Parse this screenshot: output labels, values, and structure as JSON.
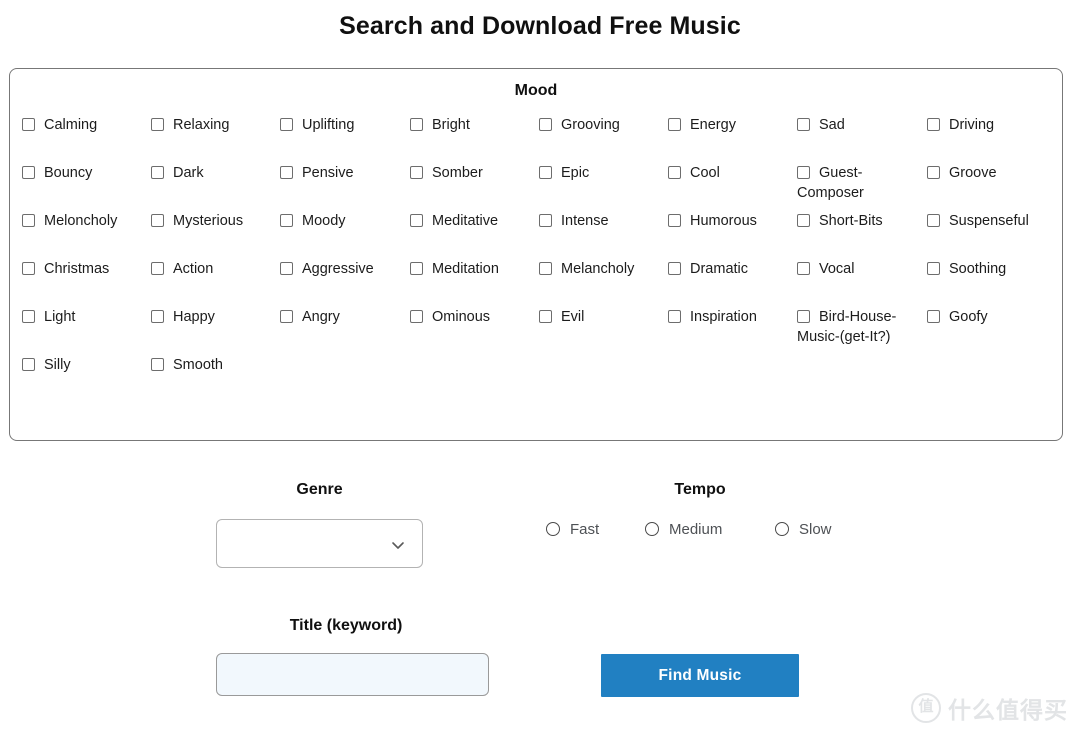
{
  "page": {
    "title": "Search and Download Free Music"
  },
  "mood": {
    "legend": "Mood",
    "rows": [
      [
        "Calming",
        "Relaxing",
        "Uplifting",
        "Bright",
        "Grooving",
        "Energy",
        "Sad",
        "Driving"
      ],
      [
        "Bouncy",
        "Dark",
        "Pensive",
        "Somber",
        "Epic",
        "Cool",
        "Guest-Composer",
        "Groove"
      ],
      [
        "Meloncholy",
        "Mysterious",
        "Moody",
        "Meditative",
        "Intense",
        "Humorous",
        "Short-Bits",
        "Suspenseful"
      ],
      [
        "Christmas",
        "Action",
        "Aggressive",
        "Meditation",
        "Melancholy",
        "Dramatic",
        "Vocal",
        "Soothing"
      ],
      [
        "Light",
        "Happy",
        "Angry",
        "Ominous",
        "Evil",
        "Inspiration",
        "Bird-House-Music-(get-It?)",
        "Goofy"
      ],
      [
        "Silly",
        "Smooth"
      ]
    ]
  },
  "genre": {
    "label": "Genre",
    "selected": "",
    "icon": "chevron-down-icon"
  },
  "tempo": {
    "label": "Tempo",
    "options": [
      "Fast",
      "Medium",
      "Slow"
    ],
    "selected": ""
  },
  "title_keyword": {
    "label": "Title (keyword)",
    "value": "",
    "placeholder": ""
  },
  "actions": {
    "find_music": "Find Music"
  },
  "watermark": {
    "badge": "值",
    "text": "什么值得买"
  },
  "colors": {
    "button_blue": "#2180c2",
    "input_fill": "#f2f8fd",
    "box_border": "#777777",
    "text": "#1c1c1c",
    "tempo_label": "#4e5155",
    "watermark": "#e2e4e6"
  }
}
